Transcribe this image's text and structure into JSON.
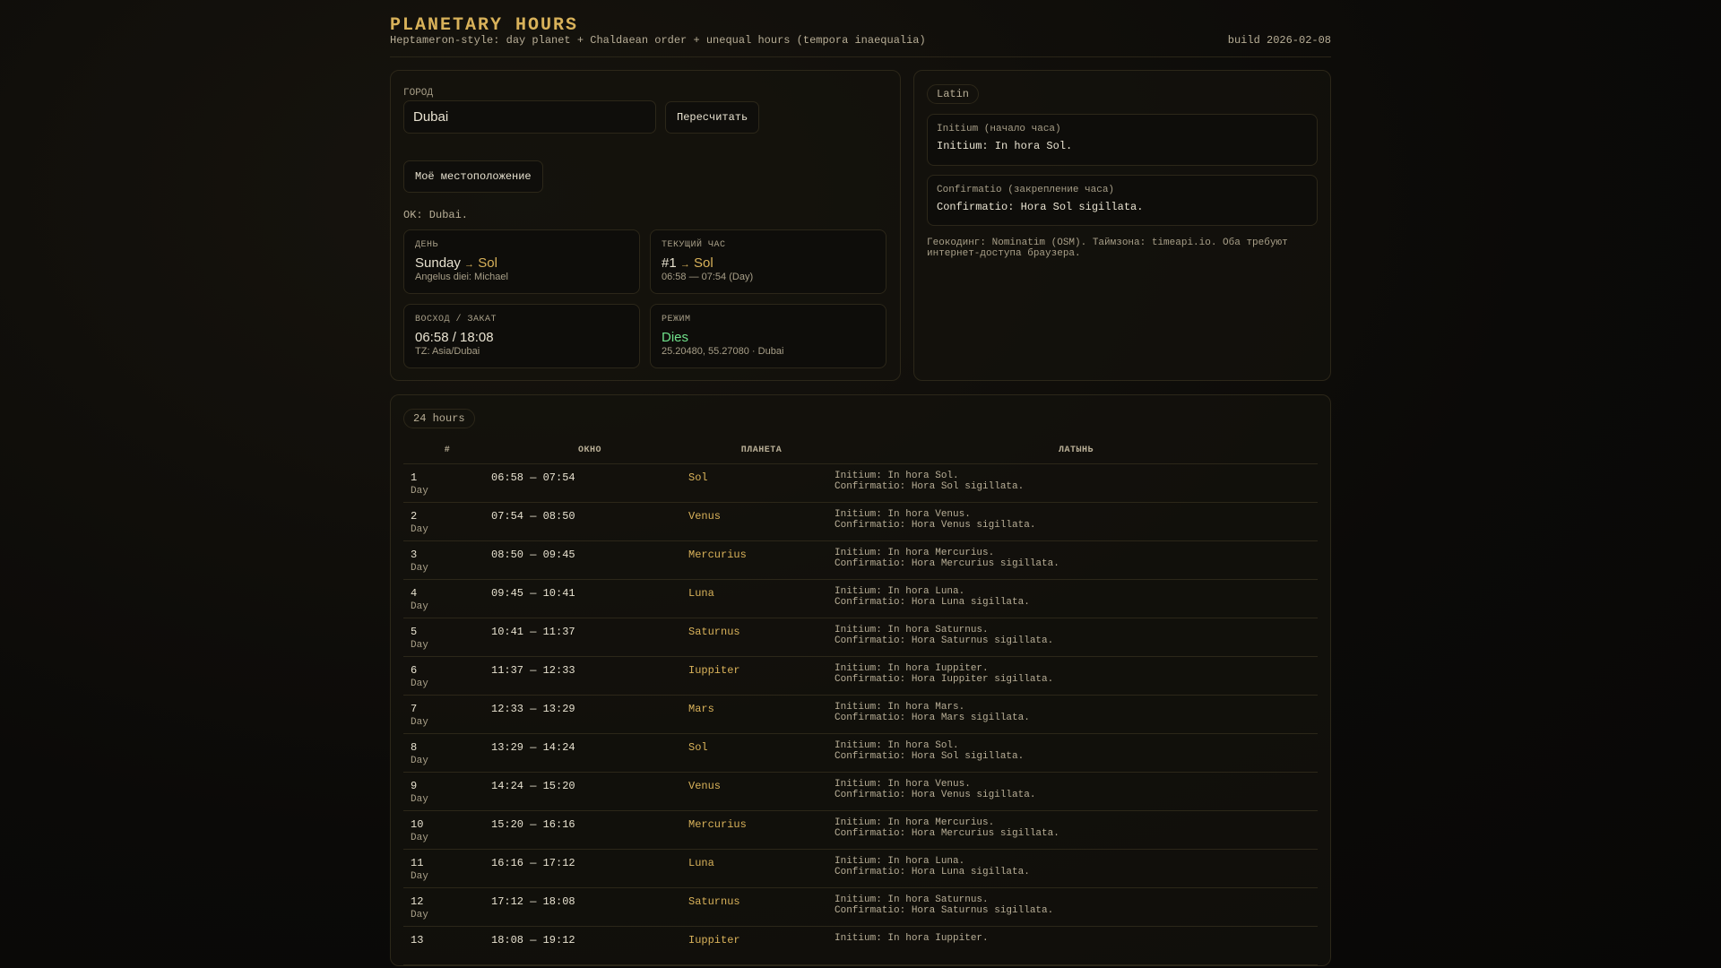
{
  "header": {
    "title": "PLANETARY HOURS",
    "subtitle": "Heptameron-style: day planet + Chaldaean order + unequal hours (tempora inaequalia)",
    "build": "build 2026-02-08"
  },
  "controls": {
    "city_label": "ГОРОД",
    "city_value": "Dubai",
    "recalc": "Пересчитать",
    "my_location": "Моё местоположение",
    "status": "OK: Dubai."
  },
  "cards": {
    "day": {
      "label": "ДЕНЬ",
      "value": "Sunday",
      "arrow": "→",
      "planet": "Sol",
      "sub": "Angelus diei: Michael"
    },
    "hour": {
      "label": "ТЕКУЩИЙ ЧАС",
      "value": "#1",
      "arrow": "→",
      "planet": "Sol",
      "sub": "06:58 — 07:54 (Day)"
    },
    "sun": {
      "label": "ВОСХОД / ЗАКАТ",
      "value": "06:58 / 18:08",
      "sub": "TZ: Asia/Dubai"
    },
    "mode": {
      "label": "РЕЖИМ",
      "value": "Dies",
      "sub": "25.20480, 55.27080 · Dubai"
    }
  },
  "latin": {
    "pill": "Latin",
    "initium_label": "Initium (начало часа)",
    "initium": "Initium: In hora Sol.",
    "confirm_label": "Confirmatio (закрепление часа)",
    "confirm": "Confirmatio: Hora Sol sigillata.",
    "note": "Геокодинг: Nominatim (OSM). Таймзона: timeapi.io. Оба требуют интернет-доступа браузера."
  },
  "table": {
    "pill": "24 hours",
    "columns": [
      "#",
      "ОКНО",
      "ПЛАНЕТА",
      "ЛАТЫНЬ"
    ],
    "rows": [
      {
        "n": "1",
        "part": "Day",
        "win": "06:58 — 07:54",
        "planet": "Sol",
        "l1": "Initium: In hora Sol.",
        "l2": "Confirmatio: Hora Sol sigillata."
      },
      {
        "n": "2",
        "part": "Day",
        "win": "07:54 — 08:50",
        "planet": "Venus",
        "l1": "Initium: In hora Venus.",
        "l2": "Confirmatio: Hora Venus sigillata."
      },
      {
        "n": "3",
        "part": "Day",
        "win": "08:50 — 09:45",
        "planet": "Mercurius",
        "l1": "Initium: In hora Mercurius.",
        "l2": "Confirmatio: Hora Mercurius sigillata."
      },
      {
        "n": "4",
        "part": "Day",
        "win": "09:45 — 10:41",
        "planet": "Luna",
        "l1": "Initium: In hora Luna.",
        "l2": "Confirmatio: Hora Luna sigillata."
      },
      {
        "n": "5",
        "part": "Day",
        "win": "10:41 — 11:37",
        "planet": "Saturnus",
        "l1": "Initium: In hora Saturnus.",
        "l2": "Confirmatio: Hora Saturnus sigillata."
      },
      {
        "n": "6",
        "part": "Day",
        "win": "11:37 — 12:33",
        "planet": "Iuppiter",
        "l1": "Initium: In hora Iuppiter.",
        "l2": "Confirmatio: Hora Iuppiter sigillata."
      },
      {
        "n": "7",
        "part": "Day",
        "win": "12:33 — 13:29",
        "planet": "Mars",
        "l1": "Initium: In hora Mars.",
        "l2": "Confirmatio: Hora Mars sigillata."
      },
      {
        "n": "8",
        "part": "Day",
        "win": "13:29 — 14:24",
        "planet": "Sol",
        "l1": "Initium: In hora Sol.",
        "l2": "Confirmatio: Hora Sol sigillata."
      },
      {
        "n": "9",
        "part": "Day",
        "win": "14:24 — 15:20",
        "planet": "Venus",
        "l1": "Initium: In hora Venus.",
        "l2": "Confirmatio: Hora Venus sigillata."
      },
      {
        "n": "10",
        "part": "Day",
        "win": "15:20 — 16:16",
        "planet": "Mercurius",
        "l1": "Initium: In hora Mercurius.",
        "l2": "Confirmatio: Hora Mercurius sigillata."
      },
      {
        "n": "11",
        "part": "Day",
        "win": "16:16 — 17:12",
        "planet": "Luna",
        "l1": "Initium: In hora Luna.",
        "l2": "Confirmatio: Hora Luna sigillata."
      },
      {
        "n": "12",
        "part": "Day",
        "win": "17:12 — 18:08",
        "planet": "Saturnus",
        "l1": "Initium: In hora Saturnus.",
        "l2": "Confirmatio: Hora Saturnus sigillata."
      },
      {
        "n": "13",
        "part": "",
        "win": "18:08 — 19:12",
        "planet": "Iuppiter",
        "l1": "Initium: In hora Iuppiter.",
        "l2": ""
      }
    ]
  }
}
